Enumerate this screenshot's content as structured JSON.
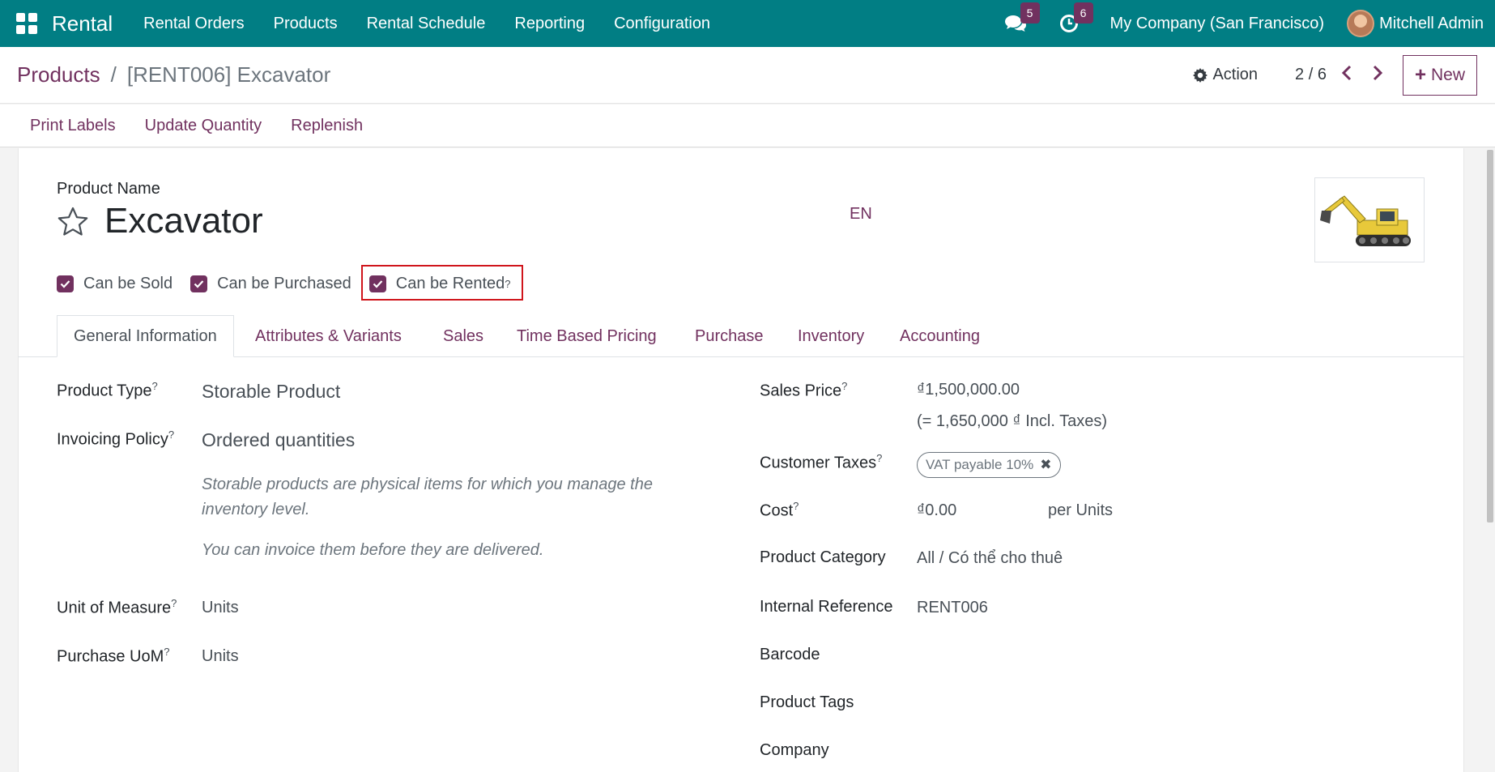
{
  "navbar": {
    "app_name": "Rental",
    "menu": [
      "Rental Orders",
      "Products",
      "Rental Schedule",
      "Reporting",
      "Configuration"
    ],
    "messages_count": "5",
    "activities_count": "6",
    "company": "My Company (San Francisco)",
    "user": "Mitchell Admin"
  },
  "control": {
    "breadcrumb_parent": "Products",
    "breadcrumb_current": "[RENT006] Excavator",
    "action_label": "Action",
    "pager": "2 / 6",
    "new_label": "New"
  },
  "buttons": [
    "Print Labels",
    "Update Quantity",
    "Replenish"
  ],
  "product": {
    "name_label": "Product Name",
    "name": "Excavator",
    "lang": "EN",
    "can_be_sold": "Can be Sold",
    "can_be_purchased": "Can be Purchased",
    "can_be_rented": "Can be Rented"
  },
  "tabs": [
    "General Information",
    "Attributes & Variants",
    "Sales",
    "Time Based Pricing",
    "Purchase",
    "Inventory",
    "Accounting"
  ],
  "general": {
    "product_type_label": "Product Type",
    "product_type": "Storable Product",
    "invoicing_policy_label": "Invoicing Policy",
    "invoicing_policy": "Ordered quantities",
    "help_1": "Storable products are physical items for which you manage the inventory level.",
    "help_2": "You can invoice them before they are delivered.",
    "uom_label": "Unit of Measure",
    "uom": "Units",
    "purchase_uom_label": "Purchase UoM",
    "purchase_uom": "Units",
    "sales_price_label": "Sales Price",
    "sales_price": "₫1,500,000.00",
    "sales_price_incl": "(= 1,650,000 ₫ Incl. Taxes)",
    "customer_taxes_label": "Customer Taxes",
    "customer_tax": "VAT payable 10%",
    "cost_label": "Cost",
    "cost": "₫0.00",
    "cost_unit": "per Units",
    "category_label": "Product Category",
    "category": "All / Có thể cho thuê",
    "internal_ref_label": "Internal Reference",
    "internal_ref": "RENT006",
    "barcode_label": "Barcode",
    "tags_label": "Product Tags",
    "company_label": "Company"
  }
}
